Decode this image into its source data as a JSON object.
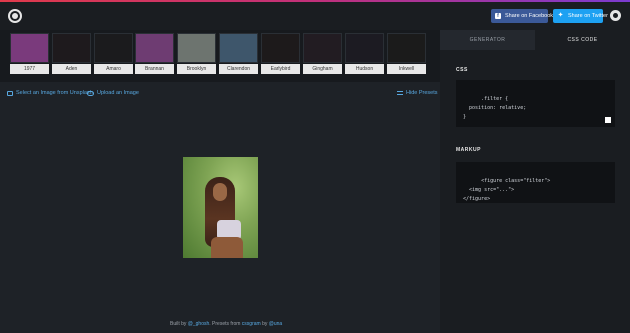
{
  "header": {
    "share_facebook": "Share on Facebook",
    "share_twitter": "Share on Twitter"
  },
  "presets": [
    {
      "label": "1977",
      "color": "#7a3a7c"
    },
    {
      "label": "Aden",
      "color": "#1e1a1d"
    },
    {
      "label": "Amaro",
      "color": "#1b1b1d"
    },
    {
      "label": "Brannan",
      "color": "#6e3c72"
    },
    {
      "label": "Brooklyn",
      "color": "#6d746f"
    },
    {
      "label": "Clarendon",
      "color": "#3e566b"
    },
    {
      "label": "Earlybird",
      "color": "#1d1a1b"
    },
    {
      "label": "Gingham",
      "color": "#221c22"
    },
    {
      "label": "Hudson",
      "color": "#1c1b22"
    },
    {
      "label": "Inkwell",
      "color": "#1b1b1b"
    }
  ],
  "actions": {
    "select_unsplash": "Select an Image from Unsplash",
    "upload_image": "Upload an Image",
    "hide_presets": "Hide Presets"
  },
  "footer": {
    "built_by": "Built by",
    "author": "@_ghosh",
    "presets_from": ". Presets from",
    "source": "cssgram",
    "by": "by",
    "credit": "@una"
  },
  "panel": {
    "tab_generator": "Generator",
    "tab_css": "CSS Code",
    "css_title": "CSS",
    "css_code": ".filter {\n  position: relative;\n}",
    "markup_title": "MARKUP",
    "markup_code": "<figure class=\"filter\">\n  <img src=\"...\">\n</figure>"
  }
}
